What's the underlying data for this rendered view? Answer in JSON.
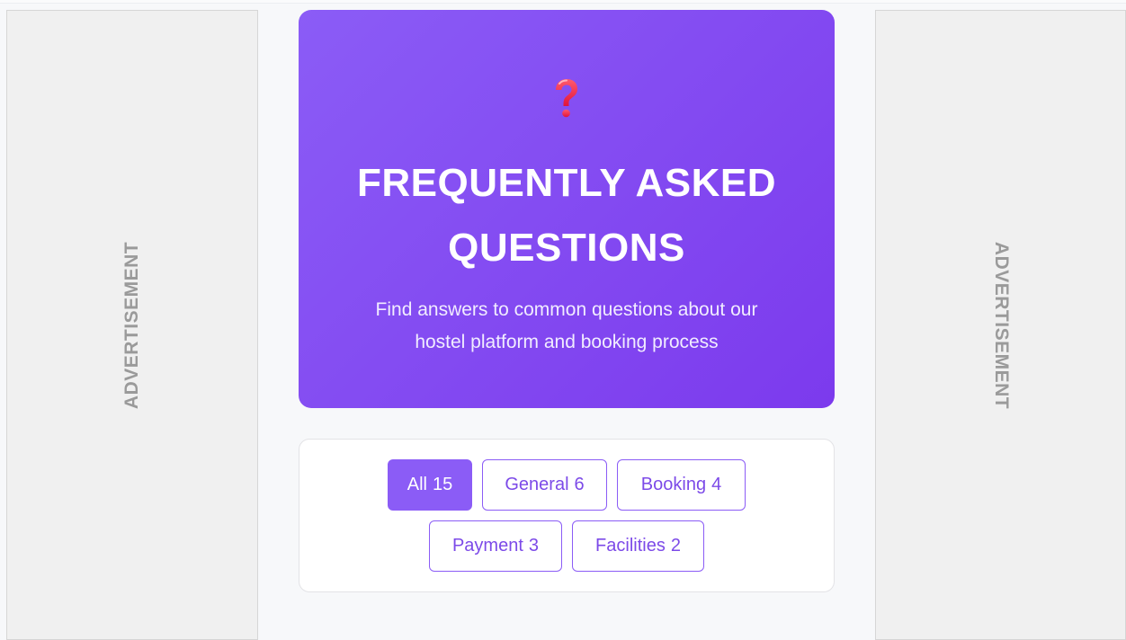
{
  "ads": {
    "left_label": "ADVERTISEMENT",
    "right_label": "ADVERTISEMENT"
  },
  "hero": {
    "icon": "question-mark-icon",
    "title_line1": "FREQUENTLY ASKED",
    "title_line2": "QUESTIONS",
    "subtitle_line1": "Find answers to common questions about our",
    "subtitle_line2": "hostel platform and booking process",
    "gradient_start": "#8b5cf6",
    "gradient_end": "#7c3aed"
  },
  "filters": {
    "items": [
      {
        "label": "All",
        "count": "15",
        "active": true
      },
      {
        "label": "General",
        "count": "6",
        "active": false
      },
      {
        "label": "Booking",
        "count": "4",
        "active": false
      },
      {
        "label": "Payment",
        "count": "3",
        "active": false
      },
      {
        "label": "Facilities",
        "count": "2",
        "active": false
      }
    ],
    "accent_color": "#8b5cf6"
  }
}
